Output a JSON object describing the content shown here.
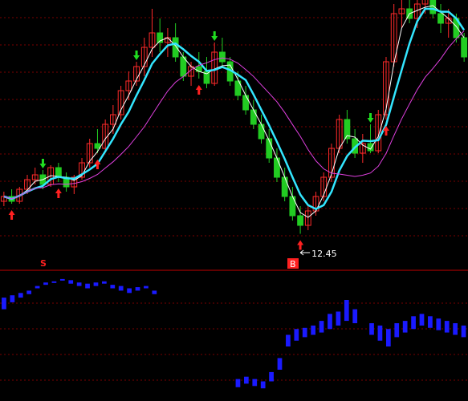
{
  "colors": {
    "background": "#000000",
    "up_candle": "#ff2a2a",
    "down_candle": "#22cc22",
    "ma_fast": "#ffffff",
    "ma_mid": "#33e6ff",
    "ma_slow": "#e040e0",
    "grid": "#7a0000",
    "divider": "#c00000",
    "volume_bar": "#1a1aff",
    "buy_arrow": "#ff2020",
    "sell_arrow": "#20dd20",
    "low_label": "#ffffff"
  },
  "chart_data": {
    "type": "candlestick",
    "price_panel": {
      "low_annotation": "12.45",
      "low_value": 12.45,
      "grid": true,
      "ylim": [
        12.0,
        22.0
      ],
      "candles": [
        [
          13.8,
          14.2,
          13.6,
          14.0
        ],
        [
          14.0,
          14.3,
          13.7,
          13.8
        ],
        [
          13.8,
          14.4,
          13.7,
          14.3
        ],
        [
          14.3,
          14.9,
          14.1,
          14.7
        ],
        [
          14.7,
          15.2,
          14.5,
          14.9
        ],
        [
          14.9,
          15.1,
          14.3,
          14.5
        ],
        [
          14.5,
          15.3,
          14.4,
          15.2
        ],
        [
          15.2,
          15.4,
          14.6,
          14.8
        ],
        [
          14.8,
          15.0,
          14.2,
          14.4
        ],
        [
          14.4,
          14.9,
          14.1,
          14.8
        ],
        [
          14.8,
          15.6,
          14.7,
          15.4
        ],
        [
          15.4,
          16.4,
          15.2,
          16.2
        ],
        [
          16.2,
          16.8,
          15.8,
          16.0
        ],
        [
          16.0,
          17.2,
          15.9,
          17.0
        ],
        [
          17.0,
          17.8,
          16.6,
          17.4
        ],
        [
          17.4,
          18.6,
          17.2,
          18.4
        ],
        [
          18.4,
          19.2,
          18.0,
          18.8
        ],
        [
          18.8,
          19.6,
          18.6,
          19.4
        ],
        [
          19.4,
          20.6,
          19.0,
          20.2
        ],
        [
          20.2,
          21.8,
          19.8,
          20.8
        ],
        [
          20.8,
          21.4,
          20.0,
          20.4
        ],
        [
          20.4,
          21.0,
          19.8,
          20.6
        ],
        [
          20.6,
          21.2,
          19.6,
          19.8
        ],
        [
          19.8,
          20.0,
          18.8,
          19.0
        ],
        [
          19.0,
          19.6,
          18.6,
          19.4
        ],
        [
          19.4,
          20.0,
          18.9,
          19.2
        ],
        [
          19.2,
          19.8,
          18.5,
          18.7
        ],
        [
          18.7,
          20.4,
          18.6,
          20.0
        ],
        [
          20.0,
          20.6,
          19.4,
          19.6
        ],
        [
          19.6,
          19.8,
          18.6,
          18.8
        ],
        [
          18.8,
          19.2,
          18.0,
          18.2
        ],
        [
          18.2,
          18.6,
          17.4,
          17.6
        ],
        [
          17.6,
          18.0,
          16.8,
          17.0
        ],
        [
          17.0,
          17.4,
          16.2,
          16.4
        ],
        [
          16.4,
          16.8,
          15.4,
          15.6
        ],
        [
          15.6,
          16.0,
          14.6,
          14.8
        ],
        [
          14.8,
          15.2,
          13.8,
          14.0
        ],
        [
          14.0,
          14.4,
          13.0,
          13.2
        ],
        [
          13.2,
          13.6,
          12.45,
          12.8
        ],
        [
          12.8,
          13.6,
          12.6,
          13.4
        ],
        [
          13.4,
          14.2,
          13.2,
          14.0
        ],
        [
          14.0,
          15.0,
          13.8,
          14.8
        ],
        [
          14.8,
          16.2,
          14.6,
          16.0
        ],
        [
          16.0,
          17.4,
          15.8,
          17.2
        ],
        [
          17.2,
          17.6,
          16.2,
          16.4
        ],
        [
          16.4,
          16.8,
          15.6,
          15.8
        ],
        [
          15.8,
          16.6,
          15.4,
          16.2
        ],
        [
          16.2,
          17.0,
          15.8,
          15.9
        ],
        [
          15.9,
          17.6,
          15.8,
          17.4
        ],
        [
          17.4,
          19.8,
          17.2,
          19.6
        ],
        [
          19.6,
          22.0,
          19.4,
          21.6
        ],
        [
          21.6,
          22.6,
          21.0,
          21.8
        ],
        [
          21.8,
          22.4,
          21.2,
          21.4
        ],
        [
          21.4,
          22.2,
          21.0,
          22.0
        ],
        [
          22.0,
          22.8,
          21.6,
          22.2
        ],
        [
          22.2,
          22.6,
          21.4,
          21.6
        ],
        [
          21.6,
          22.0,
          20.8,
          21.2
        ],
        [
          21.2,
          21.8,
          20.6,
          21.4
        ],
        [
          21.4,
          21.6,
          20.4,
          20.6
        ],
        [
          20.6,
          20.8,
          19.6,
          19.8
        ]
      ]
    },
    "indicator_panel": {
      "marker_labels": [
        "S",
        "B"
      ],
      "grid": true,
      "bars": [
        [
          72,
          82
        ],
        [
          78,
          84
        ],
        [
          82,
          86
        ],
        [
          85,
          88
        ],
        [
          90,
          92
        ],
        [
          93,
          95
        ],
        [
          95,
          96
        ],
        [
          97,
          98
        ],
        [
          94,
          97
        ],
        [
          92,
          95
        ],
        [
          90,
          94
        ],
        [
          92,
          95
        ],
        [
          94,
          96
        ],
        [
          90,
          93
        ],
        [
          88,
          92
        ],
        [
          86,
          90
        ],
        [
          88,
          91
        ],
        [
          90,
          92
        ],
        [
          85,
          88
        ],
        [
          null,
          null
        ],
        [
          null,
          null
        ],
        [
          null,
          null
        ],
        [
          null,
          null
        ],
        [
          null,
          null
        ],
        [
          null,
          null
        ],
        [
          null,
          null
        ],
        [
          null,
          null
        ],
        [
          null,
          null
        ],
        [
          5,
          12
        ],
        [
          8,
          14
        ],
        [
          6,
          12
        ],
        [
          4,
          10
        ],
        [
          10,
          18
        ],
        [
          20,
          30
        ],
        [
          40,
          50
        ],
        [
          45,
          55
        ],
        [
          48,
          56
        ],
        [
          50,
          58
        ],
        [
          52,
          62
        ],
        [
          55,
          68
        ],
        [
          58,
          70
        ],
        [
          62,
          80
        ],
        [
          60,
          72
        ],
        [
          null,
          null
        ],
        [
          50,
          60
        ],
        [
          45,
          58
        ],
        [
          40,
          55
        ],
        [
          48,
          60
        ],
        [
          52,
          62
        ],
        [
          55,
          66
        ],
        [
          58,
          68
        ],
        [
          56,
          66
        ],
        [
          54,
          64
        ],
        [
          52,
          62
        ],
        [
          50,
          60
        ],
        [
          48,
          58
        ]
      ]
    }
  }
}
